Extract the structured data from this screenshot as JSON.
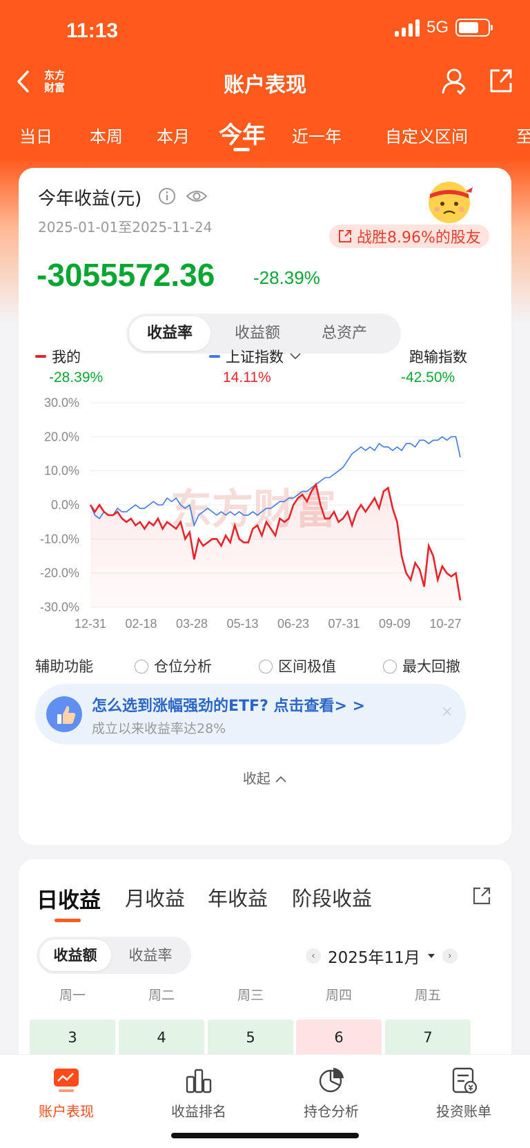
{
  "status": {
    "time": "11:13",
    "network": "5G"
  },
  "nav": {
    "logo_line1": "东方",
    "logo_line2": "财富",
    "title": "账户表现"
  },
  "period_tabs": [
    "当日",
    "本周",
    "本月",
    "今年",
    "近一年",
    "自定义区间",
    "至"
  ],
  "summary": {
    "title": "今年收益(元)",
    "date_range": "2025-01-01至2025-11-24",
    "beat_text": "战胜8.96%的股友",
    "profit": "-3055572.36",
    "profit_pct": "-28.39%"
  },
  "metric_tabs": [
    "收益率",
    "收益额",
    "总资产"
  ],
  "legend": {
    "mine_label": "我的",
    "mine_value": "-28.39%",
    "index_label": "上证指数",
    "index_value": "14.11%",
    "diff_label": "跑输指数",
    "diff_value": "-42.50%"
  },
  "colors": {
    "brand": "#ff5a1c",
    "mine": "#e8242b",
    "index": "#3f7ae6",
    "gain": "#e8242b",
    "loss": "#0aa632"
  },
  "chart_data": {
    "type": "line",
    "x_ticks": [
      "12-31",
      "02-18",
      "03-28",
      "05-13",
      "06-23",
      "07-31",
      "09-09",
      "10-27"
    ],
    "y_ticks": [
      "30.0%",
      "20.0%",
      "10.0%",
      "0.0%",
      "-10.0%",
      "-20.0%",
      "-30.0%"
    ],
    "ylim": [
      -30,
      30
    ],
    "watermark": "东方财富",
    "series": [
      {
        "name": "我的",
        "x": [
          0,
          4,
          8,
          12,
          16,
          20,
          24,
          28,
          32,
          36,
          40,
          44,
          48,
          52,
          56,
          60,
          64,
          68,
          72,
          76,
          80,
          84,
          88,
          92,
          96,
          100,
          104,
          108,
          112,
          116,
          120,
          124,
          128,
          132,
          136,
          140,
          144,
          148,
          152,
          156,
          160,
          164,
          168,
          172,
          176,
          180,
          184,
          188,
          192,
          196,
          200,
          204,
          208,
          212,
          216,
          220,
          224,
          228,
          232,
          236,
          240,
          244,
          248,
          252,
          256,
          260,
          264,
          268,
          272,
          276,
          280,
          284,
          288,
          292,
          296,
          300,
          304,
          308,
          312,
          316,
          320,
          324,
          328
        ],
        "values": [
          0,
          -2,
          0,
          -2,
          -3,
          -3,
          -2,
          -4,
          -5,
          -4,
          -6,
          -5,
          -7,
          -5,
          -6,
          -4,
          -7,
          -5,
          -6,
          -7,
          -5,
          -10,
          -8,
          -16,
          -10,
          -12,
          -11,
          -10,
          -10,
          -12,
          -9,
          -11,
          -6,
          -10,
          -11,
          -11,
          -7,
          -6,
          -9,
          -5,
          -7,
          -9,
          -4,
          -5,
          -4,
          0,
          2,
          3,
          1,
          4,
          6,
          0,
          -4,
          -4,
          -2,
          -5,
          -4,
          -2,
          -6,
          -2,
          0,
          -2,
          0,
          2,
          -1,
          4,
          5,
          -1,
          -5,
          -15,
          -20,
          -22,
          -17,
          -19,
          -24,
          -12,
          -15,
          -22,
          -18,
          -20,
          -21,
          -20,
          -28
        ]
      },
      {
        "name": "上证指数",
        "x": [
          0,
          4,
          8,
          12,
          16,
          20,
          24,
          28,
          32,
          36,
          40,
          44,
          48,
          52,
          56,
          60,
          64,
          68,
          72,
          76,
          80,
          84,
          88,
          92,
          96,
          100,
          104,
          108,
          112,
          116,
          120,
          124,
          128,
          132,
          136,
          140,
          144,
          148,
          152,
          156,
          160,
          164,
          168,
          172,
          176,
          180,
          184,
          188,
          192,
          196,
          200,
          204,
          208,
          212,
          216,
          220,
          224,
          228,
          232,
          236,
          240,
          244,
          248,
          252,
          256,
          260,
          264,
          268,
          272,
          276,
          280,
          284,
          288,
          292,
          296,
          300,
          304,
          308,
          312,
          316,
          320,
          324,
          328
        ],
        "values": [
          0,
          -3,
          -4,
          -2,
          -3,
          -3,
          -1,
          -2,
          -2,
          -1,
          0,
          -1,
          -1,
          0,
          1,
          0,
          0,
          2,
          1,
          2,
          0,
          -1,
          0,
          -6,
          -3,
          -2,
          -1,
          -2,
          -3,
          -2,
          -3,
          -2,
          -3,
          -2,
          -3,
          -3,
          -2,
          -3,
          -2,
          -1,
          -1,
          0,
          1,
          1,
          2,
          2,
          3,
          4,
          4,
          5,
          6,
          7,
          8,
          8,
          9,
          10,
          11,
          13,
          15,
          16,
          17,
          16,
          17,
          16,
          18,
          17,
          17,
          16,
          17,
          16,
          18,
          18,
          17,
          19,
          19,
          18,
          19,
          19,
          20,
          19,
          20,
          20,
          14
        ]
      }
    ]
  },
  "aux": {
    "label": "辅助功能",
    "options": [
      "仓位分析",
      "区间极值",
      "最大回撤"
    ]
  },
  "ad": {
    "title": "怎么选到涨幅强劲的ETF? 点击查看> >",
    "subtitle": "成立以来收益率达28%",
    "close": "×"
  },
  "collapse_label": "收起",
  "profit_tabs": [
    "日收益",
    "月收益",
    "年收益",
    "阶段收益"
  ],
  "calendar": {
    "mode_tabs": [
      "收益额",
      "收益率"
    ],
    "month": "2025年11月",
    "prev": "‹",
    "next": "›",
    "weekdays": [
      "周一",
      "周二",
      "周三",
      "周四",
      "周五"
    ],
    "days": [
      {
        "d": "3",
        "tone": "loss"
      },
      {
        "d": "4",
        "tone": "loss"
      },
      {
        "d": "5",
        "tone": "loss"
      },
      {
        "d": "6",
        "tone": "gain"
      },
      {
        "d": "7",
        "tone": "loss"
      }
    ]
  },
  "tabbar": [
    {
      "label": "账户表现",
      "icon": "trend-icon"
    },
    {
      "label": "收益排名",
      "icon": "bar-rank-icon"
    },
    {
      "label": "持仓分析",
      "icon": "pie-icon"
    },
    {
      "label": "投资账单",
      "icon": "bill-icon"
    }
  ]
}
